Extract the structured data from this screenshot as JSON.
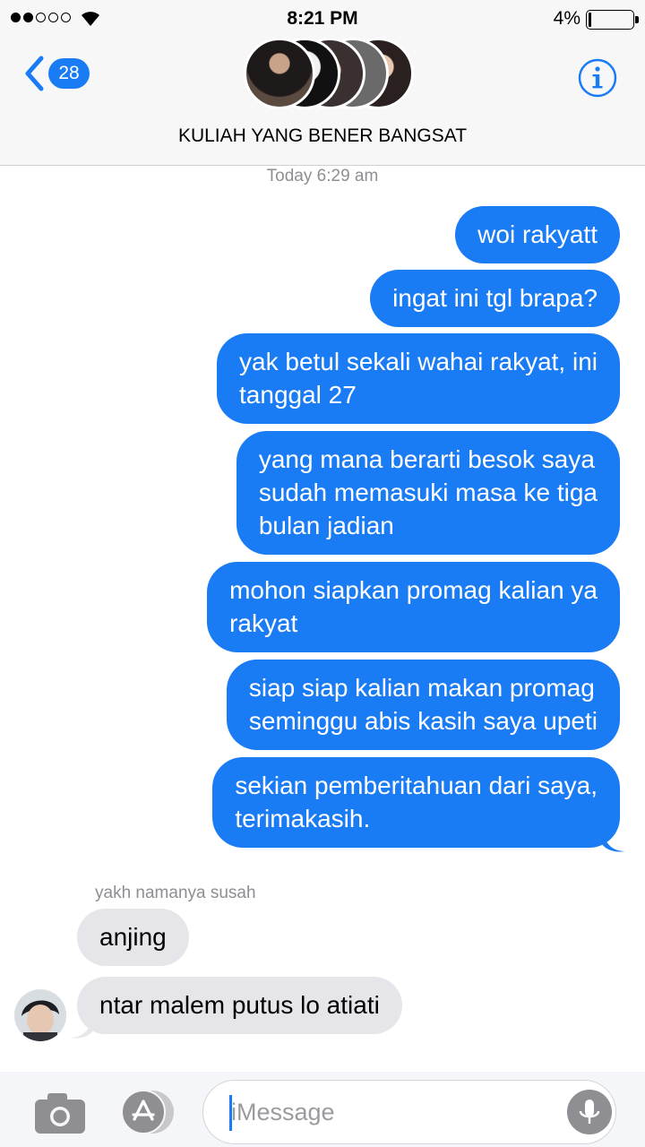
{
  "status_bar": {
    "time": "8:21 PM",
    "battery_percent": "4%",
    "signal_bars_filled": 2,
    "signal_bars_total": 5
  },
  "nav": {
    "back_count": "28",
    "title": "KULIAH YANG BENER BANGSAT"
  },
  "conversation": {
    "timestamp": "Today 6:29 am",
    "outgoing": [
      {
        "lines": [
          "woi rakyatt"
        ]
      },
      {
        "lines": [
          "ingat ini tgl brapa?"
        ]
      },
      {
        "lines": [
          "yak betul sekali wahai rakyat, ini",
          "tanggal 27"
        ]
      },
      {
        "lines": [
          "yang mana berarti besok saya",
          "sudah memasuki masa ke tiga",
          "bulan jadian"
        ]
      },
      {
        "lines": [
          "mohon siapkan promag kalian ya",
          "rakyat"
        ]
      },
      {
        "lines": [
          "siap siap kalian makan promag",
          "seminggu abis kasih saya upeti"
        ]
      },
      {
        "lines": [
          "sekian pemberitahuan dari saya,",
          "terimakasih."
        ]
      }
    ],
    "incoming_sender": "yakh namanya susah",
    "incoming": [
      {
        "lines": [
          "anjing"
        ]
      },
      {
        "lines": [
          "ntar malem putus lo atiati"
        ]
      }
    ]
  },
  "input_bar": {
    "placeholder": "iMessage"
  },
  "colors": {
    "outgoing_bubble": "#1a7cf5",
    "incoming_bubble": "#e5e5ea",
    "accent": "#1a7cf5"
  },
  "icons": [
    "back-chevron-icon",
    "info-icon",
    "camera-icon",
    "app-store-icon",
    "microphone-icon",
    "wifi-icon",
    "battery-icon"
  ]
}
